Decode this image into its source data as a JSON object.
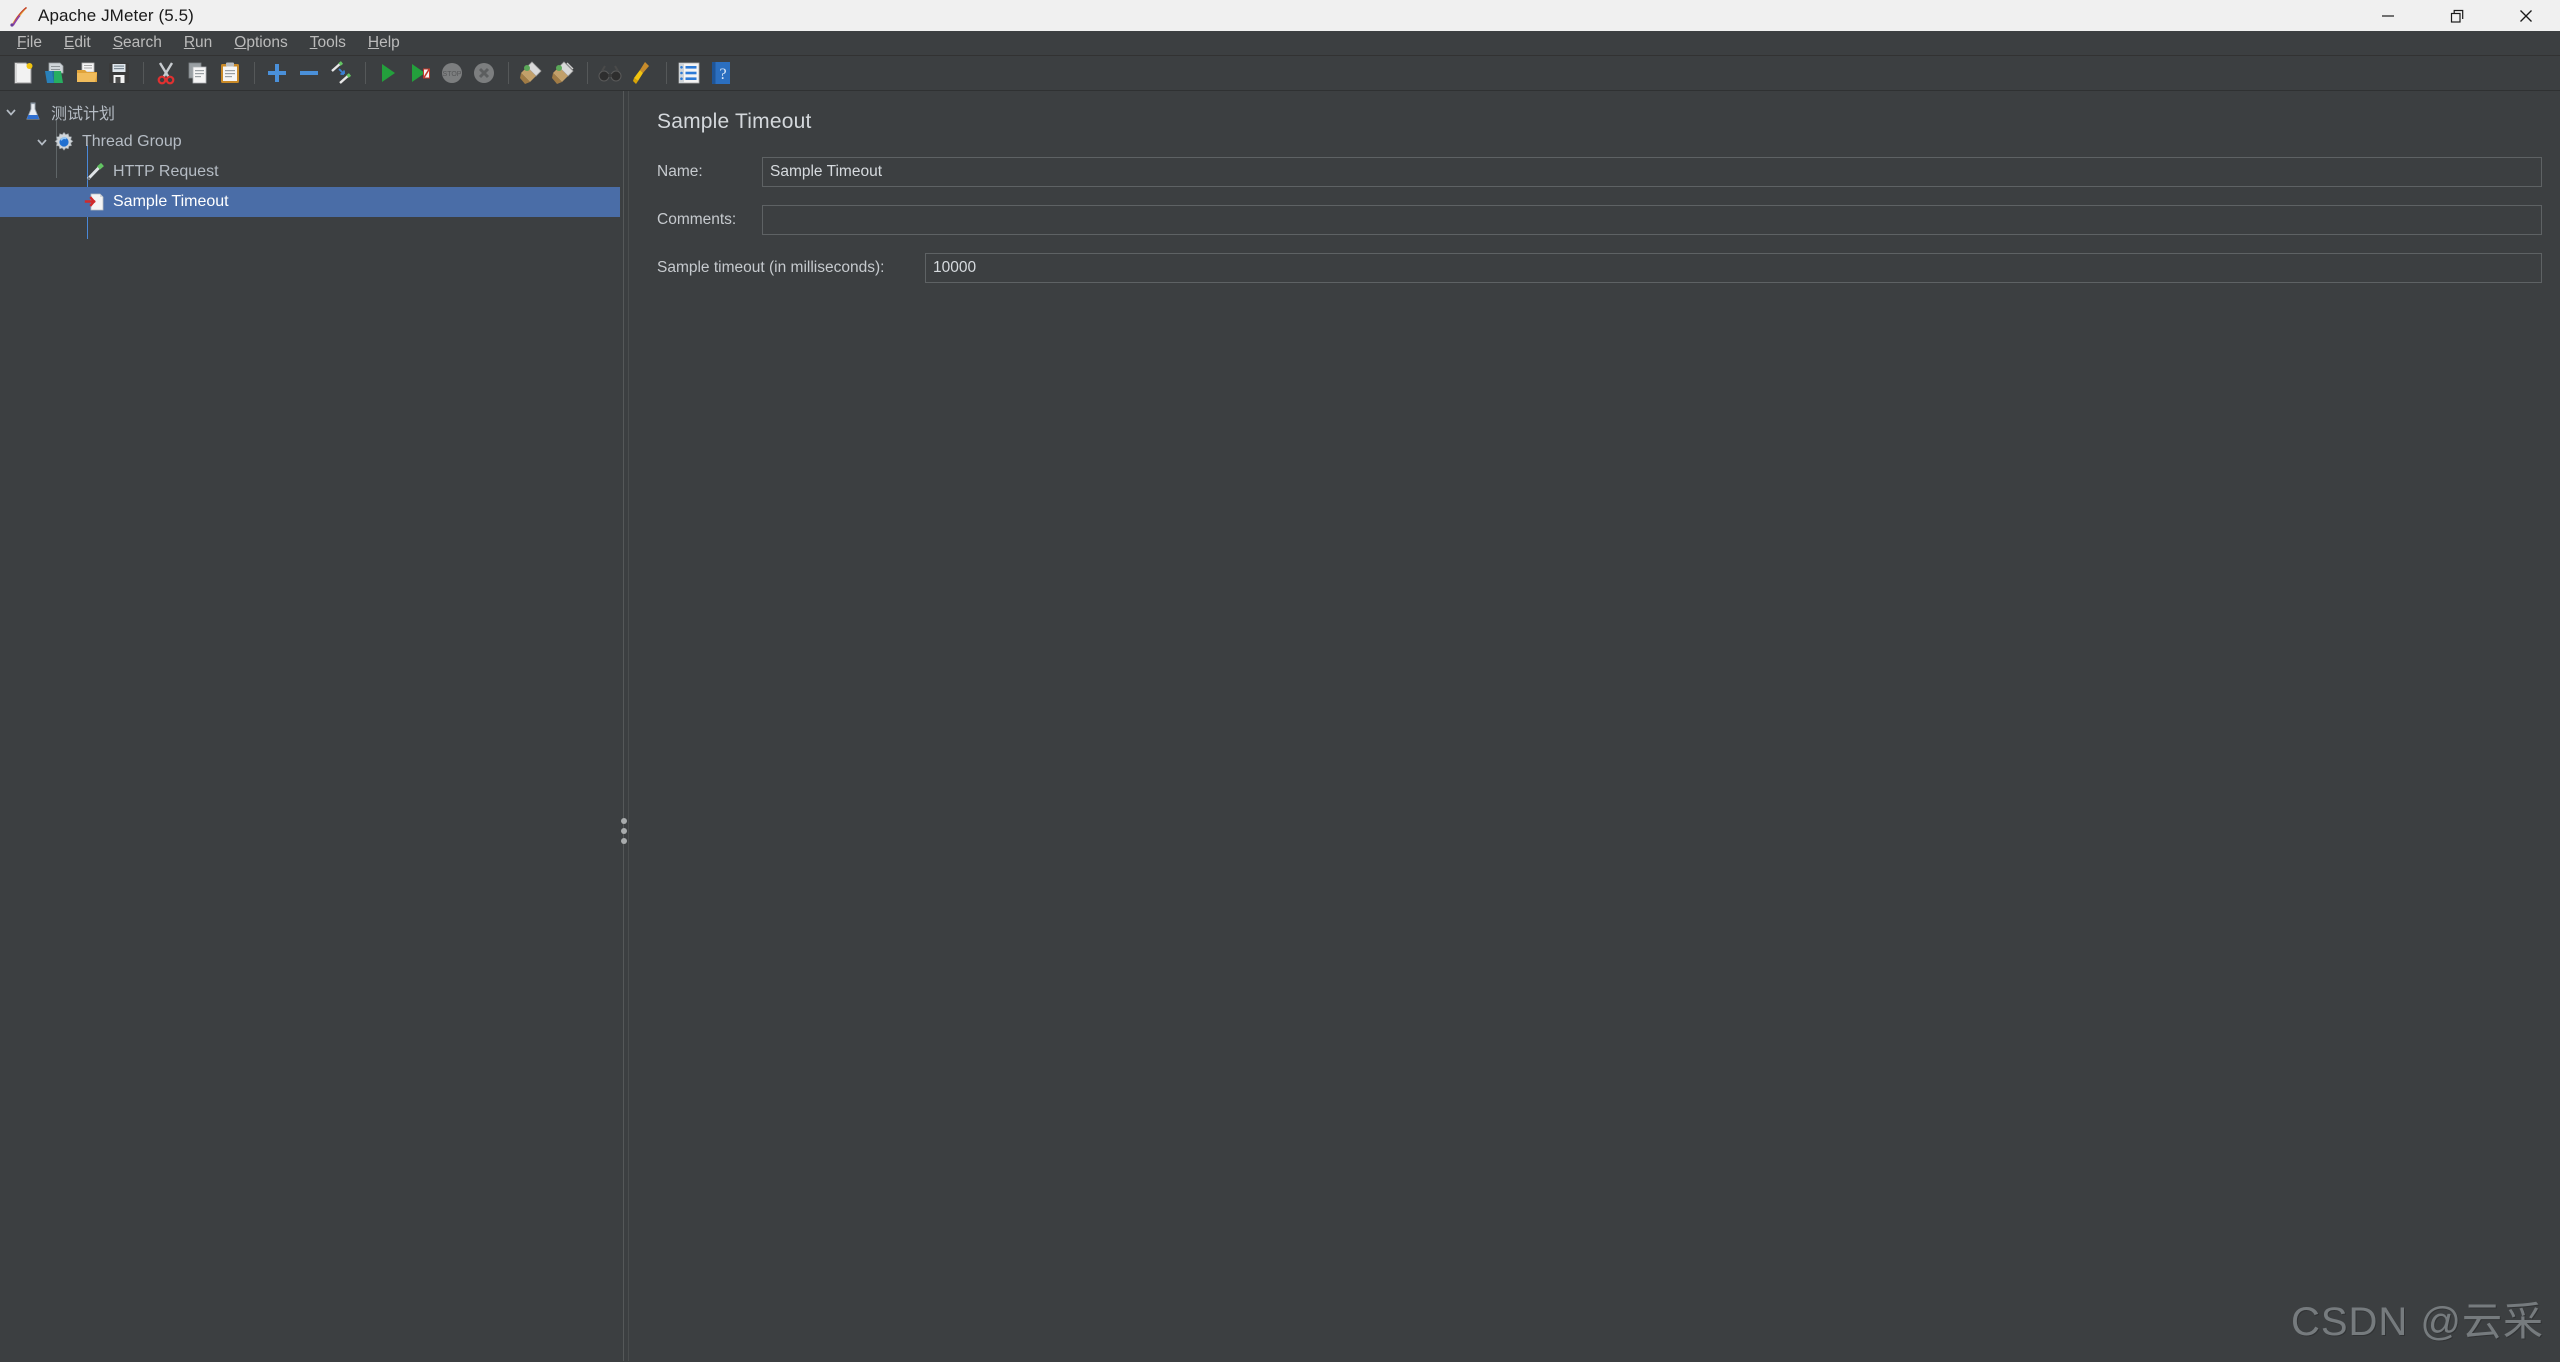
{
  "window": {
    "title": "Apache JMeter (5.5)",
    "app_icon": "jmeter-feather-icon",
    "controls": {
      "minimize": "minimize-icon",
      "restore": "restore-icon",
      "close": "close-icon"
    }
  },
  "menubar": {
    "items": [
      {
        "label": "File",
        "mnemonic": "F",
        "rest": "ile"
      },
      {
        "label": "Edit",
        "mnemonic": "E",
        "rest": "dit"
      },
      {
        "label": "Search",
        "mnemonic": "S",
        "rest": "earch"
      },
      {
        "label": "Run",
        "mnemonic": "R",
        "rest": "un"
      },
      {
        "label": "Options",
        "mnemonic": "O",
        "rest": "ptions"
      },
      {
        "label": "Tools",
        "mnemonic": "T",
        "rest": "ools"
      },
      {
        "label": "Help",
        "mnemonic": "H",
        "rest": "elp"
      }
    ]
  },
  "toolbar": {
    "buttons": [
      {
        "name": "new-test-plan-icon",
        "title": "New",
        "enabled": true
      },
      {
        "name": "templates-icon",
        "title": "Templates",
        "enabled": true
      },
      {
        "name": "open-icon",
        "title": "Open",
        "enabled": true
      },
      {
        "name": "save-icon",
        "title": "Save Test Plan",
        "enabled": true
      },
      {
        "name": "separator",
        "title": "",
        "enabled": true
      },
      {
        "name": "cut-icon",
        "title": "Cut",
        "enabled": true
      },
      {
        "name": "copy-icon",
        "title": "Copy",
        "enabled": true
      },
      {
        "name": "paste-icon",
        "title": "Paste",
        "enabled": true
      },
      {
        "name": "separator",
        "title": "",
        "enabled": true
      },
      {
        "name": "expand-all-icon",
        "title": "Expand All",
        "enabled": true
      },
      {
        "name": "collapse-all-icon",
        "title": "Collapse All",
        "enabled": true
      },
      {
        "name": "toggle-icon",
        "title": "Toggle",
        "enabled": true
      },
      {
        "name": "separator",
        "title": "",
        "enabled": true
      },
      {
        "name": "start-icon",
        "title": "Start",
        "enabled": true
      },
      {
        "name": "start-no-pauses-icon",
        "title": "Start no pauses",
        "enabled": true
      },
      {
        "name": "stop-icon",
        "title": "Stop",
        "enabled": false
      },
      {
        "name": "shutdown-icon",
        "title": "Shutdown",
        "enabled": false
      },
      {
        "name": "separator",
        "title": "",
        "enabled": true
      },
      {
        "name": "clear-icon",
        "title": "Clear",
        "enabled": true
      },
      {
        "name": "clear-all-icon",
        "title": "Clear All",
        "enabled": true
      },
      {
        "name": "separator",
        "title": "",
        "enabled": true
      },
      {
        "name": "search-icon",
        "title": "Search",
        "enabled": true
      },
      {
        "name": "reset-search-icon",
        "title": "Reset Search",
        "enabled": true
      },
      {
        "name": "separator",
        "title": "",
        "enabled": true
      },
      {
        "name": "function-helper-icon",
        "title": "Function Helper Dialog",
        "enabled": true
      },
      {
        "name": "help-icon",
        "title": "Help",
        "enabled": true
      }
    ]
  },
  "tree": {
    "nodes": [
      {
        "label": "测试计划",
        "icon": "test-plan-icon",
        "depth": 0,
        "expanded": true,
        "selected": false
      },
      {
        "label": "Thread Group",
        "icon": "thread-group-icon",
        "depth": 1,
        "expanded": true,
        "selected": false
      },
      {
        "label": "HTTP Request",
        "icon": "http-request-icon",
        "depth": 2,
        "expanded": null,
        "selected": false
      },
      {
        "label": "Sample Timeout",
        "icon": "sample-timeout-icon",
        "depth": 2,
        "expanded": null,
        "selected": true
      }
    ]
  },
  "panel": {
    "title": "Sample Timeout",
    "fields": [
      {
        "label": "Name:",
        "value": "Sample Timeout",
        "placeholder": ""
      },
      {
        "label": "Comments:",
        "value": "",
        "placeholder": ""
      },
      {
        "label": "Sample timeout (in milliseconds):",
        "value": "10000",
        "placeholder": ""
      }
    ]
  },
  "watermark": {
    "text": "CSDN @云采"
  },
  "colors": {
    "window_bg": "#3c3f41",
    "titlebar_bg": "#f0f0f0",
    "selection_blue": "#4a6da7",
    "text": "#b5bcc4",
    "accent_blue": "#4a88d8"
  }
}
